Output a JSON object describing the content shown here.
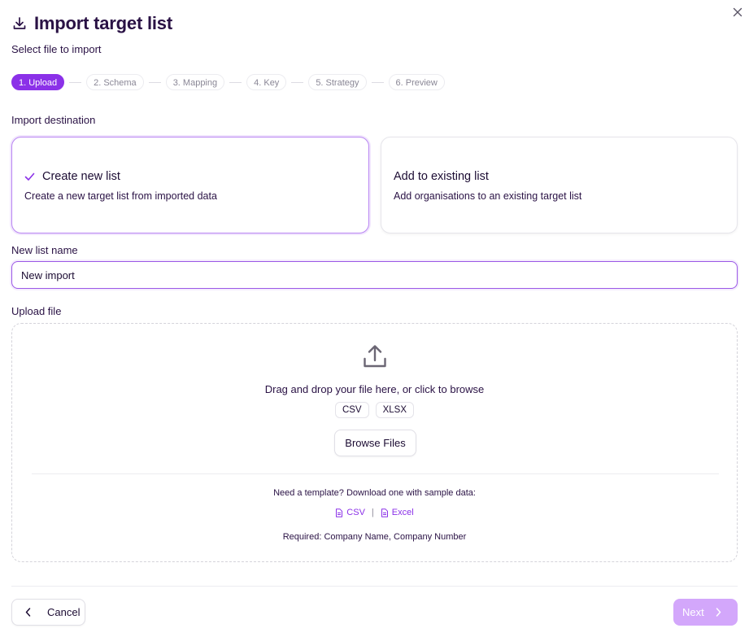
{
  "dialog": {
    "title": "Import target list",
    "subtitle": "Select file to import",
    "header_icon": "download-icon",
    "close_icon": "close-icon"
  },
  "stepper": {
    "steps": [
      {
        "label": "1. Upload",
        "active": true
      },
      {
        "label": "2. Schema",
        "active": false
      },
      {
        "label": "3. Mapping",
        "active": false
      },
      {
        "label": "4. Key",
        "active": false
      },
      {
        "label": "5. Strategy",
        "active": false
      },
      {
        "label": "6. Preview",
        "active": false
      }
    ]
  },
  "destination": {
    "label": "Import destination",
    "options": [
      {
        "title": "Create new list",
        "description": "Create a new target list from imported data",
        "selected": true
      },
      {
        "title": "Add to existing list",
        "description": "Add organisations to an existing target list",
        "selected": false
      }
    ]
  },
  "list_name": {
    "label": "New list name",
    "value": "New import"
  },
  "upload": {
    "label": "Upload file",
    "icon": "upload-icon",
    "drop_text": "Drag and drop your file here, or click to browse",
    "formats": [
      "CSV",
      "XLSX"
    ],
    "browse_label": "Browse Files",
    "template_text": "Need a template? Download one with sample data:",
    "template_links": {
      "csv": "CSV",
      "excel": "Excel",
      "separator": "|"
    },
    "required_text": "Required: Company Name, Company Number"
  },
  "footer": {
    "cancel_label": "Cancel",
    "next_label": "Next"
  },
  "colors": {
    "accent": "#8b31e8",
    "accent_light": "#d3a7fb",
    "text": "#2a1245"
  }
}
